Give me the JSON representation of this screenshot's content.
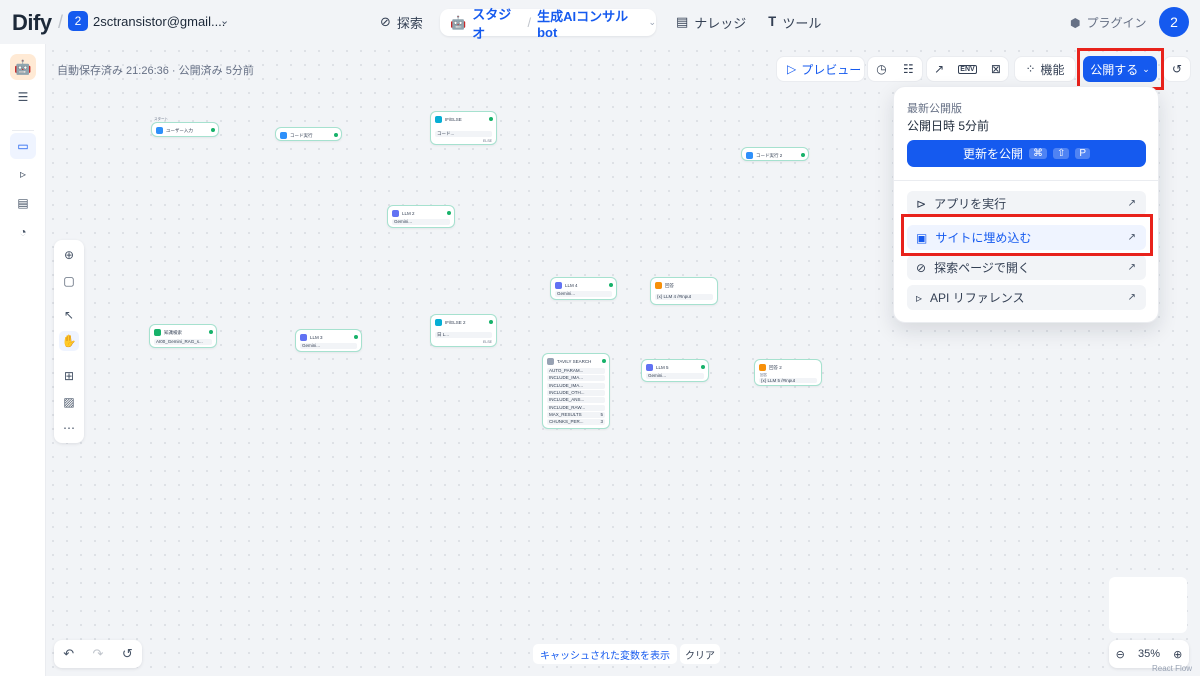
{
  "header": {
    "logo": "Dify",
    "workspace_badge": "2",
    "workspace_name": "2sctransistor@gmail....",
    "nav": {
      "explore": "探索",
      "studio": "スタジオ",
      "app_name": "生成AIコンサルbot",
      "knowledge": "ナレッジ",
      "tools": "ツール"
    },
    "plugins": "プラグイン",
    "avatar": "2"
  },
  "status": {
    "autosave": "自動保存済み 21:26:36 · 公開済み 5分前"
  },
  "toolbar": {
    "preview": "プレビュー",
    "features": "機能",
    "env": "ENV",
    "publish": "公開する"
  },
  "publish_menu": {
    "latest_label": "最新公開版",
    "published_time": "公開日時 5分前",
    "update_button": "更新を公開",
    "shortcut": [
      "⌘",
      "⇧",
      "P"
    ],
    "items": [
      {
        "label": "アプリを実行"
      },
      {
        "label": "サイトに埋め込む"
      },
      {
        "label": "探索ページで開く"
      },
      {
        "label": "API リファレンス"
      }
    ]
  },
  "bottom": {
    "cached_vars": "キャッシュされた変数を表示",
    "clear": "クリア",
    "zoom": "35%",
    "attribution": "React Flow"
  },
  "nodes": {
    "start_tag": "スタート",
    "user_input": "ユーザー入力",
    "code1": "コード実行",
    "ifelse1": "IF/ELSE",
    "ifelse1_row": "コード...",
    "ifelse1_else": "ELSE",
    "code2": "コード実行 2",
    "llm2": "LLM 2",
    "llm2_model": "Gemini...",
    "kb": "知識検索",
    "kb_row": "AI00_Gemini_RAG_s...",
    "llm3": "LLM 3",
    "llm3_model": "Gemini...",
    "ifelse2": "IF/ELSE 2",
    "ifelse2_row": "日 L...",
    "ifelse2_else": "ELSE",
    "llm4": "LLM 4",
    "llm4_model": "Gemini...",
    "answer1": "回答",
    "answer1_row": "{x} LLM 4 /#Input",
    "tavily": "TAVILY SEARCH",
    "tavily_rows": [
      "AUTO_PARAM...",
      "INCLUDE_IMA...",
      "INCLUDE_IMA...",
      "INCLUDE_OTH...",
      "INCLUDE_ANS...",
      "INCLUDE_RAW...",
      "MAX_RESULTS",
      "CHUNKS_PER..."
    ],
    "tavily_vals": [
      "",
      "",
      "",
      "",
      "",
      "",
      "5",
      "3"
    ],
    "llm5": "LLM 5",
    "llm5_model": "Gemini...",
    "answer2": "回答 2",
    "answer2_label": "回答",
    "answer2_row": "{x} LLM 5 /#Input"
  }
}
